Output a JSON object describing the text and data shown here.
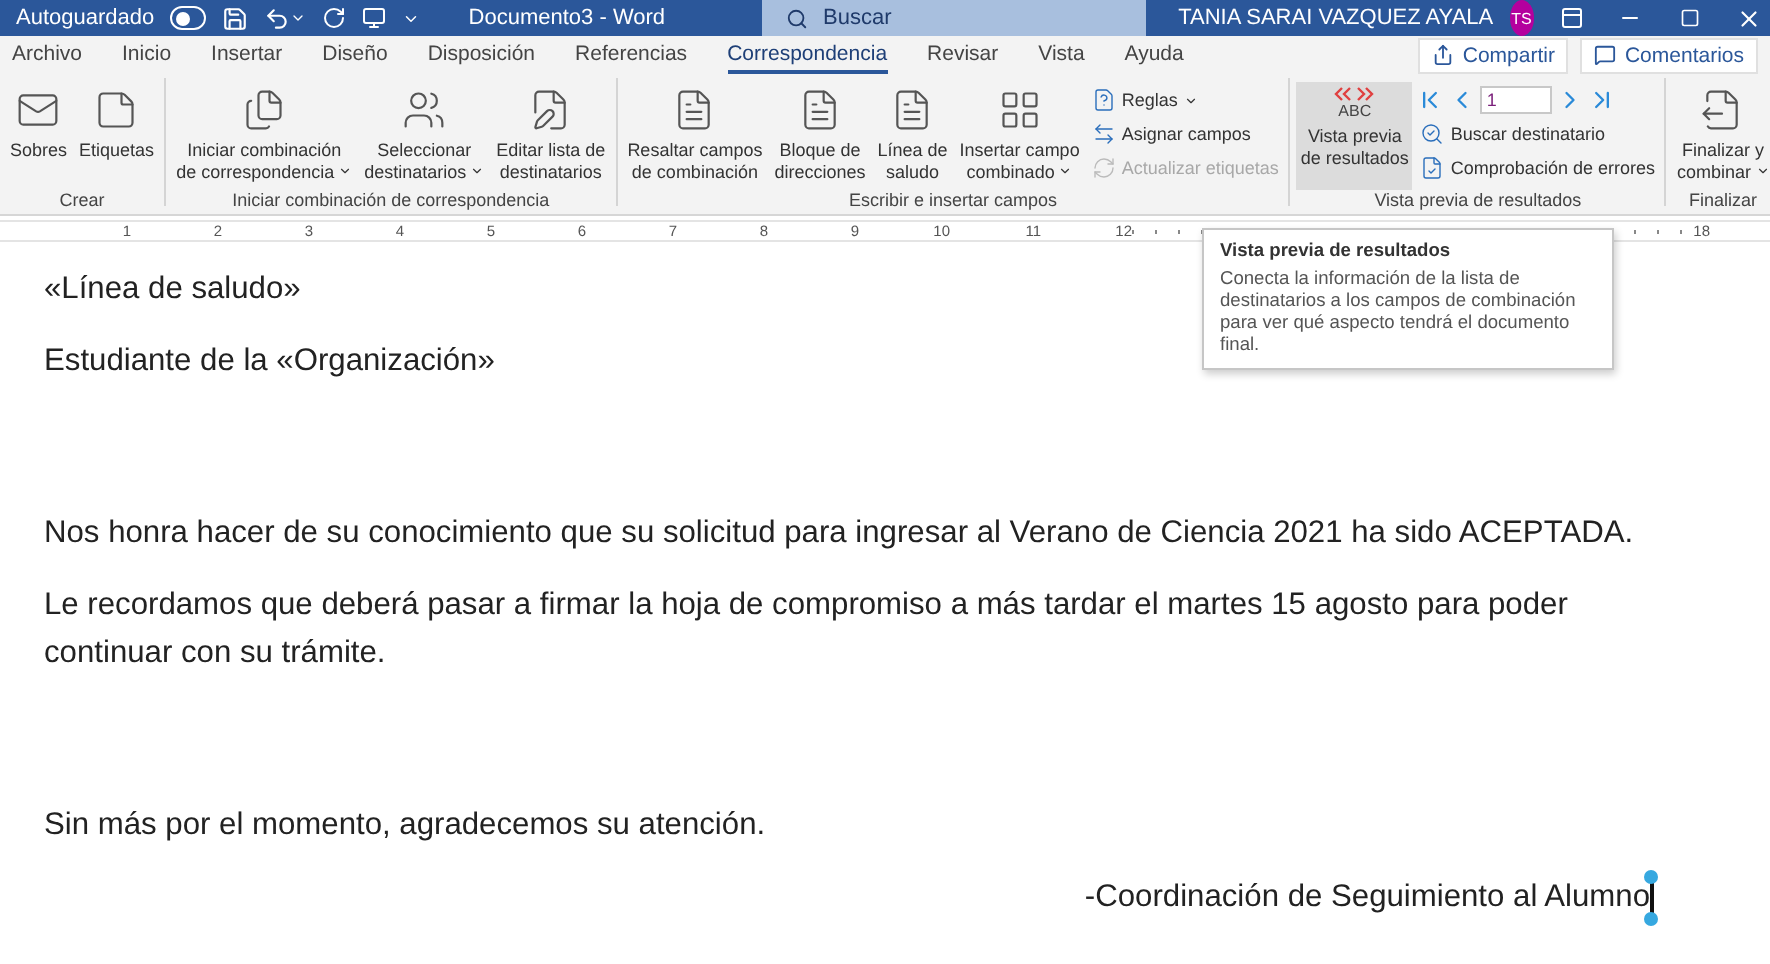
{
  "title_bar": {
    "autosave": {
      "label": "Autoguardado",
      "on": false
    },
    "document_title": "Documento3  -  Word",
    "search_placeholder": "Buscar",
    "user_name": "TANIA SARAI VAZQUEZ AYALA",
    "avatar_initials": "TS"
  },
  "tabs": [
    {
      "label": "Archivo",
      "selected": false
    },
    {
      "label": "Inicio",
      "selected": false
    },
    {
      "label": "Insertar",
      "selected": false
    },
    {
      "label": "Diseño",
      "selected": false
    },
    {
      "label": "Disposición",
      "selected": false
    },
    {
      "label": "Referencias",
      "selected": false
    },
    {
      "label": "Correspondencia",
      "selected": true
    },
    {
      "label": "Revisar",
      "selected": false
    },
    {
      "label": "Vista",
      "selected": false
    },
    {
      "label": "Ayuda",
      "selected": false
    }
  ],
  "share_button": "Compartir",
  "comments_button": "Comentarios",
  "ribbon": {
    "groups": [
      {
        "label": "Crear",
        "items": [
          {
            "kind": "large",
            "label_lines": [
              "Sobres"
            ],
            "dropdown": false,
            "on": false
          },
          {
            "kind": "large",
            "label_lines": [
              "Etiquetas"
            ],
            "dropdown": false,
            "on": false
          }
        ]
      },
      {
        "label": "Iniciar combinación de correspondencia",
        "items": [
          {
            "kind": "large",
            "label_lines": [
              "Iniciar combinación",
              "de correspondencia"
            ],
            "dropdown": true,
            "on": false
          },
          {
            "kind": "large",
            "label_lines": [
              "Seleccionar",
              "destinatarios"
            ],
            "dropdown": true,
            "on": false
          },
          {
            "kind": "large",
            "label_lines": [
              "Editar lista de",
              "destinatarios"
            ],
            "dropdown": false,
            "on": false
          }
        ]
      },
      {
        "label": "Escribir e insertar campos",
        "items": [
          {
            "kind": "large",
            "label_lines": [
              "Resaltar campos",
              "de combinación"
            ],
            "dropdown": false,
            "on": false
          },
          {
            "kind": "large",
            "label_lines": [
              "Bloque de",
              "direcciones"
            ],
            "dropdown": false,
            "on": false
          },
          {
            "kind": "large",
            "label_lines": [
              "Línea de",
              "saludo"
            ],
            "dropdown": false,
            "on": false
          },
          {
            "kind": "large",
            "label_lines": [
              "Insertar campo",
              "combinado"
            ],
            "dropdown": true,
            "on": false
          },
          {
            "kind": "small",
            "label": "Reglas",
            "dropdown": true,
            "disabled": false
          },
          {
            "kind": "small",
            "label": "Asignar campos",
            "dropdown": false,
            "disabled": false
          },
          {
            "kind": "small",
            "label": "Actualizar etiquetas",
            "dropdown": false,
            "disabled": true
          }
        ]
      },
      {
        "label": "Vista previa de resultados",
        "items": [
          {
            "kind": "large",
            "icon_text": "ABC",
            "label_lines": [
              "Vista previa",
              "de resultados"
            ],
            "dropdown": false,
            "on": true
          },
          {
            "kind": "navigator",
            "record": "1"
          },
          {
            "kind": "small",
            "label": "Buscar destinatario",
            "dropdown": false,
            "disabled": false
          },
          {
            "kind": "small",
            "label": "Comprobación de errores",
            "dropdown": false,
            "disabled": false
          }
        ]
      },
      {
        "label": "Finalizar",
        "items": [
          {
            "kind": "large",
            "label_lines": [
              "Finalizar y",
              "combinar"
            ],
            "dropdown": true,
            "on": false
          }
        ]
      }
    ]
  },
  "ruler": {
    "numbers": [
      "1",
      "2",
      "3",
      "4",
      "5",
      "6",
      "7",
      "8",
      "9",
      "10",
      "11",
      "12",
      "18"
    ]
  },
  "tooltip": {
    "title": "Vista previa de resultados",
    "text": "Conecta la información de la lista de destinatarios a los campos de combinación para ver qué aspecto tendrá el documento final."
  },
  "document": {
    "sections": [
      {
        "paragraphs": [
          {
            "kind": "body",
            "text": "«Línea de saludo»"
          },
          {
            "kind": "body",
            "text": "Estudiante de la «Organización»"
          }
        ]
      },
      {
        "paragraphs": [
          {
            "kind": "body",
            "text": "Nos honra hacer de su conocimiento que su solicitud para ingresar al Verano de Ciencia 2021 ha sido ACEPTADA."
          },
          {
            "kind": "body",
            "text": "Le recordamos que deberá pasar a firmar la hoja de compromiso a más tardar el martes 15 agosto para poder continuar con su trámite."
          }
        ]
      },
      {
        "paragraphs": [
          {
            "kind": "body",
            "text": "Sin más por el momento, agradecemos su atención."
          },
          {
            "kind": "signature",
            "text": "-Coordinación de Seguimiento al Alumno",
            "cursor": true
          }
        ]
      }
    ]
  }
}
